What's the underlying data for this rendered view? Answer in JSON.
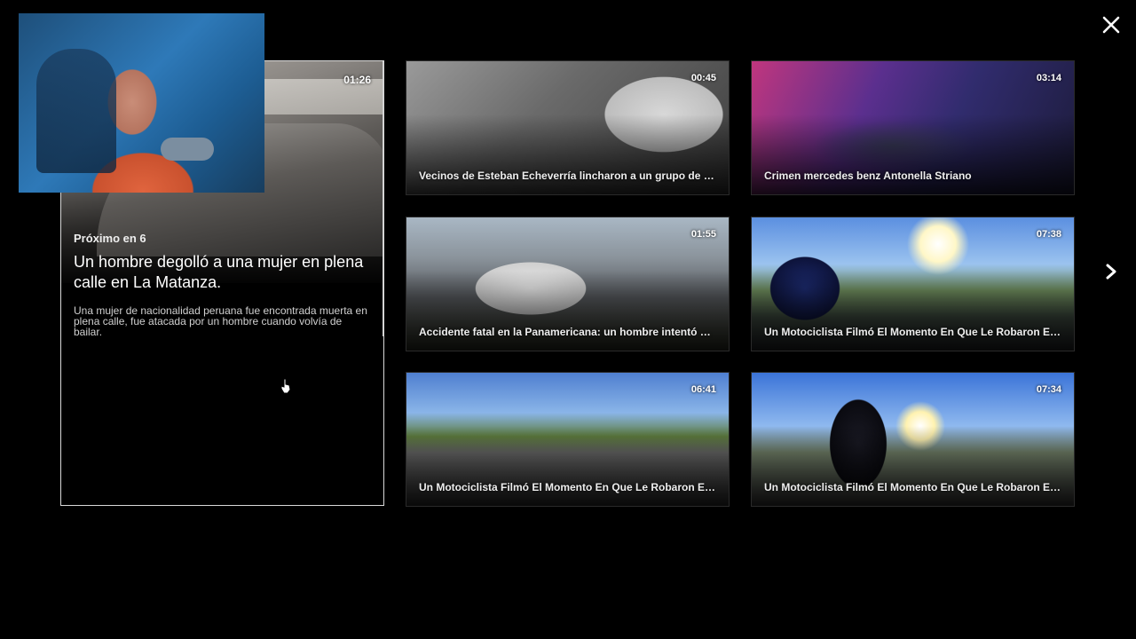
{
  "controls": {
    "close_icon": "close-x-icon",
    "next_icon": "chevron-right-icon"
  },
  "featured": {
    "duration": "01:26",
    "countdown": "Próximo en 6",
    "title": "Un hombre degolló a una mujer en plena calle en La Matanza.",
    "description": "Una mujer de nacionalidad peruana fue encontrada muerta en plena calle, fue atacada por un hombre cuando volvía de bailar."
  },
  "videos": [
    {
      "title": "Vecinos de Esteban Echeverría lincharon a un grupo de la...",
      "duration": "00:45"
    },
    {
      "title": "Crimen mercedes benz Antonella Striano",
      "duration": "03:14"
    },
    {
      "title": "Accidente fatal en la Panamericana: un hombre intentó cr...",
      "duration": "01:55"
    },
    {
      "title": "Un Motociclista Filmó El Momento En Que Le Robaron En...",
      "duration": "07:38"
    },
    {
      "title": "Un Motociclista Filmó El Momento En Que Le Robaron En...",
      "duration": "06:41"
    },
    {
      "title": "Un Motociclista Filmó El Momento En Que Le Robaron En...",
      "duration": "07:34"
    }
  ],
  "colors": {
    "background": "#000000",
    "text": "#ffffff",
    "featured_border": "#d9d9d9"
  }
}
